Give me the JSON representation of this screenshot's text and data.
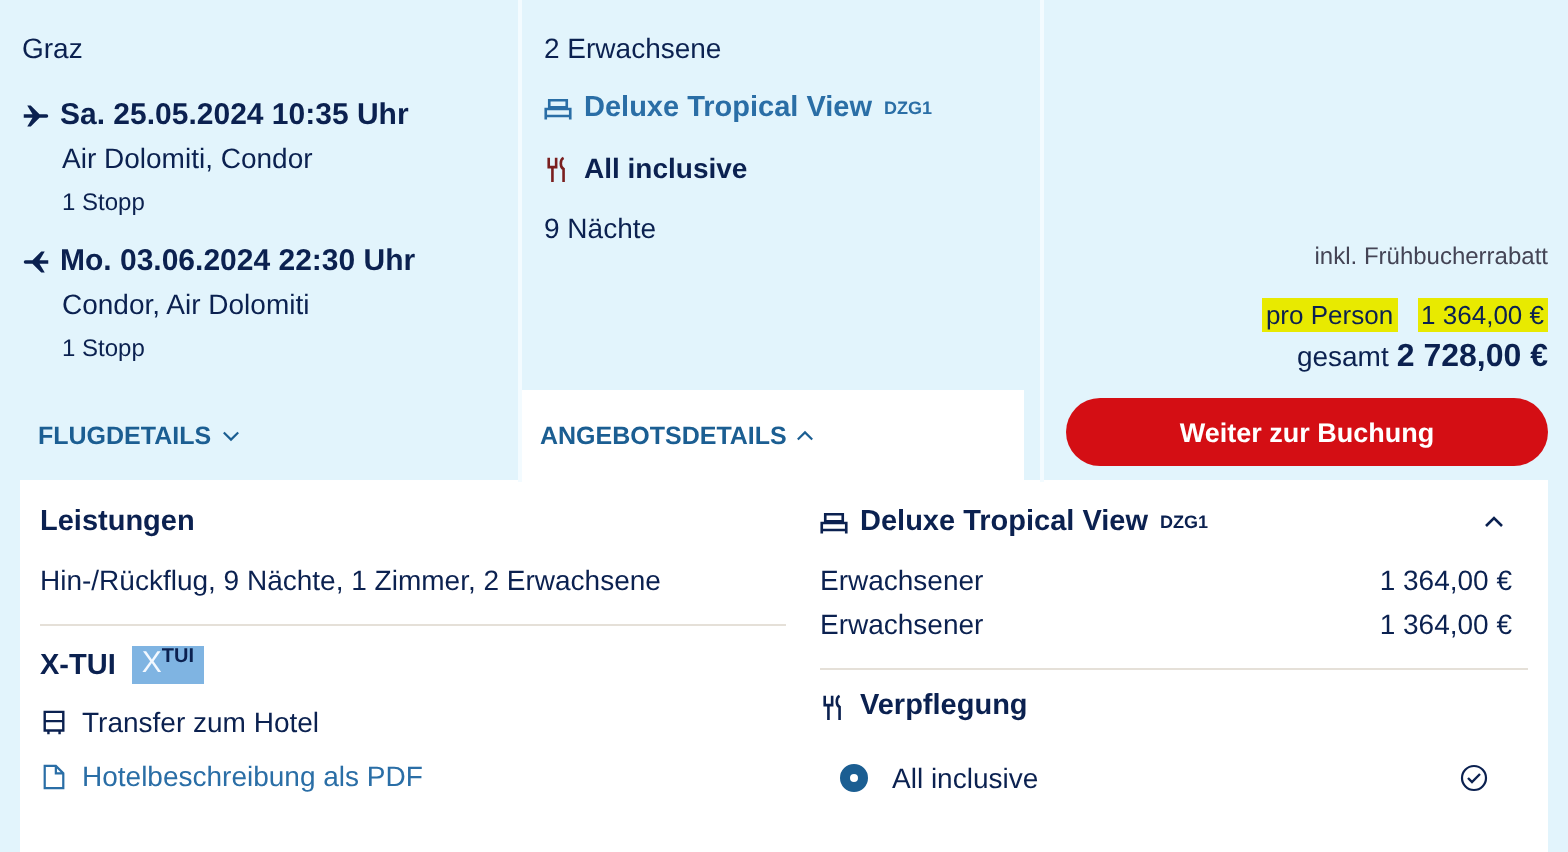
{
  "origin": "Graz",
  "flights": [
    {
      "kind": "outbound",
      "datetime": "Sa. 25.05.2024 10:35 Uhr",
      "airlines": "Air Dolomiti, Condor",
      "stops": "1 Stopp"
    },
    {
      "kind": "return",
      "datetime": "Mo. 03.06.2024 22:30 Uhr",
      "airlines": "Condor, Air Dolomiti",
      "stops": "1 Stopp"
    }
  ],
  "travellers": "2 Erwachsene",
  "room": {
    "name": "Deluxe Tropical View",
    "code": "DZG1"
  },
  "board": "All inclusive",
  "nights": "9 Nächte",
  "tabs": [
    {
      "label": "FLUGDETAILS",
      "selected": false,
      "expanded": false
    },
    {
      "label": "ANGEBOTSDETAILS",
      "selected": true,
      "expanded": true
    }
  ],
  "discount_note": "inkl. Frühbucherrabatt",
  "per_person": {
    "label": "pro Person",
    "price": "1 364,00 €",
    "highlighted": true
  },
  "total": {
    "label": "gesamt",
    "price": "2 728,00 €"
  },
  "book_button": "Weiter zur Buchung",
  "details": {
    "services_title": "Leistungen",
    "services": "Hin-/Rückflug, 9 Nächte, 1 Zimmer, 2 Erwachsene",
    "brand_title": "X-TUI",
    "brand_badge": {
      "mark": "X",
      "text": "TUI"
    },
    "transfer": "Transfer zum Hotel",
    "pdf_link": "Hotelbeschreibung als PDF"
  },
  "room_panel": {
    "name": "Deluxe Tropical View",
    "code": "DZG1",
    "expanded": true,
    "lines": [
      {
        "label": "Erwachsener",
        "price": "1 364,00 €"
      },
      {
        "label": "Erwachsener",
        "price": "1 364,00 €"
      }
    ]
  },
  "meal_panel": {
    "title": "Verpflegung",
    "options": [
      {
        "label": "All inclusive",
        "selected": true
      }
    ]
  }
}
